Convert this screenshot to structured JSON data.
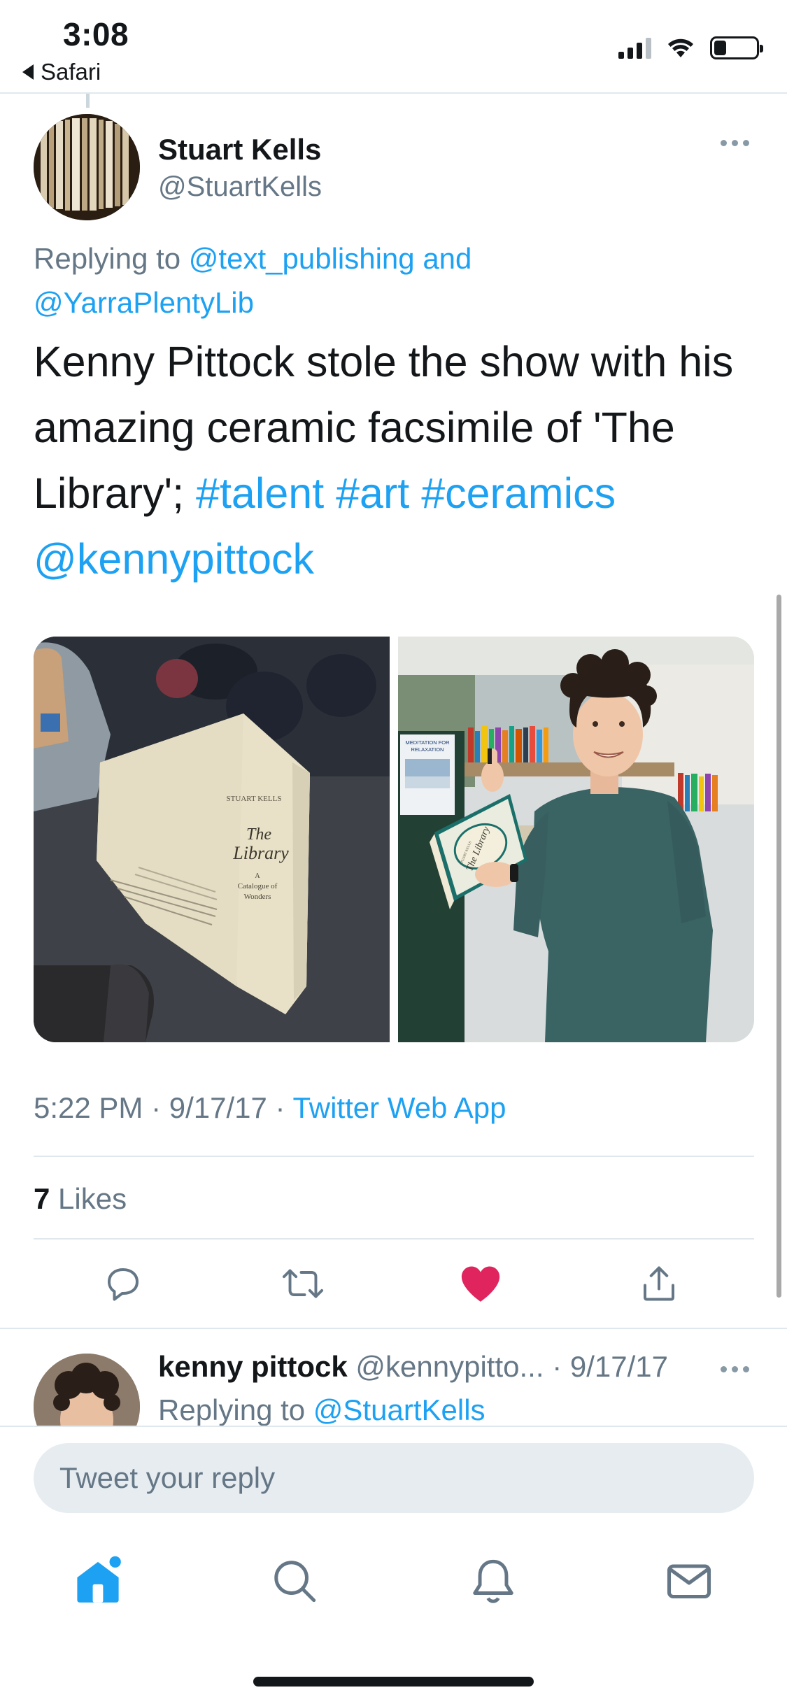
{
  "status_bar": {
    "time": "3:08",
    "back_app": "Safari"
  },
  "tweet": {
    "author_name": "Stuart Kells",
    "author_handle": "@StuartKells",
    "replying_prefix": "Replying to",
    "replying_to_1": "@text_publishing",
    "replying_and": "and",
    "replying_to_2": "@YarraPlentyLib",
    "text_main": "Kenny Pittock stole the show with his amazing ceramic facsimile of 'The Library';",
    "hashtags": [
      "#talent",
      "#art",
      "#ceramics"
    ],
    "mention": "@kennypittock",
    "photo_1": {
      "book_author": "STUART KELLS",
      "book_title_1": "The",
      "book_title_2": "Library",
      "book_subtitle_1": "A",
      "book_subtitle_2": "Catalogue of",
      "book_subtitle_3": "Wonders"
    },
    "photo_2": {
      "sign_text_1": "MEDITATION FOR",
      "sign_text_2": "RELAXATION",
      "book_author": "STUART KELLS",
      "book_title": "The Library"
    },
    "time": "5:22 PM",
    "date": "9/17/17",
    "source": "Twitter Web App",
    "likes_count": "7",
    "likes_label": "Likes",
    "liked": true
  },
  "reply": {
    "name": "kenny pittock",
    "handle": "@kennypitto...",
    "date": "9/17/17",
    "replying_prefix": "Replying to",
    "replying_to": "@StuartKells"
  },
  "composer": {
    "placeholder": "Tweet your reply"
  },
  "colors": {
    "link": "#1da1f2",
    "like": "#e0245e",
    "secondary_text": "#657786"
  },
  "icons": {
    "actions": [
      "reply-icon",
      "retweet-icon",
      "like-icon",
      "share-icon"
    ],
    "tabs": [
      "home-icon",
      "search-icon",
      "notifications-icon",
      "messages-icon"
    ]
  }
}
